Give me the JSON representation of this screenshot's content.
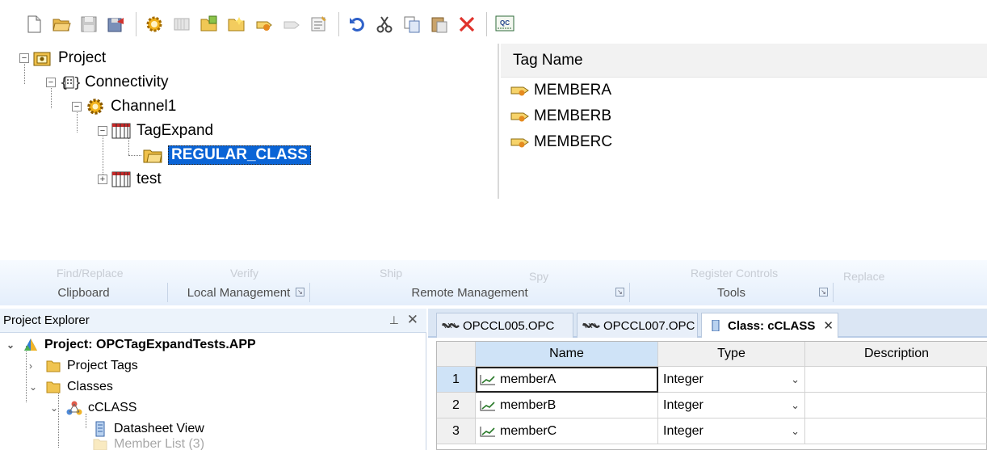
{
  "top": {
    "toolbar": {
      "icons": [
        "new-file-icon",
        "open-folder-icon",
        "save-icon",
        "save-all-icon",
        "new-channel-icon",
        "new-device-icon",
        "new-tag-group-icon",
        "new-folder-icon",
        "new-tag-icon",
        "bulk-tag-icon",
        "properties-icon",
        "undo-icon",
        "cut-icon",
        "copy-icon",
        "paste-icon",
        "delete-icon",
        "quick-client-icon"
      ],
      "qc_label": "QC"
    },
    "tree": {
      "project": "Project",
      "connectivity": "Connectivity",
      "channel": "Channel1",
      "device": "TagExpand",
      "selected": "REGULAR_CLASS",
      "test": "test",
      "expanded_symbol": "−",
      "collapsed_symbol": "+"
    },
    "tag_list": {
      "header": "Tag Name",
      "rows": [
        "MEMBERA",
        "MEMBERB",
        "MEMBERC"
      ]
    }
  },
  "bottom": {
    "ribbon": {
      "faded": [
        "Find/Replace",
        "Verify",
        "Ship",
        "Spy",
        "Register Controls",
        "Replace"
      ],
      "groups": [
        "Clipboard",
        "Local Management",
        "Remote Management",
        "Tools"
      ],
      "launcher_symbol": "↘"
    },
    "explorer": {
      "title": "Project Explorer",
      "pin_symbol": "⊥",
      "close_symbol": "✕",
      "project": "Project: OPCTagExpandTests.APP",
      "project_tags": "Project Tags",
      "classes": "Classes",
      "cclass": "cCLASS",
      "datasheet": "Datasheet View",
      "member_list": "Member List (3)",
      "chev_open": "⌄",
      "chev_closed": "›"
    },
    "tabs": [
      {
        "label": "OPCCL005.OPC"
      },
      {
        "label": "OPCCL007.OPC"
      },
      {
        "label": "Class: cCLASS",
        "close": "✕"
      }
    ],
    "grid": {
      "headers": [
        "Name",
        "Type",
        "Description"
      ],
      "rows": [
        {
          "num": "1",
          "name": "memberA",
          "type": "Integer"
        },
        {
          "num": "2",
          "name": "memberB",
          "type": "Integer"
        },
        {
          "num": "3",
          "name": "memberC",
          "type": "Integer"
        }
      ],
      "dropdown_symbol": "⌄"
    },
    "colors": {
      "selection": "#0a64d6",
      "ribbon_bg": "#e4eefb",
      "grid_header_selected": "#cfe3f7"
    }
  }
}
